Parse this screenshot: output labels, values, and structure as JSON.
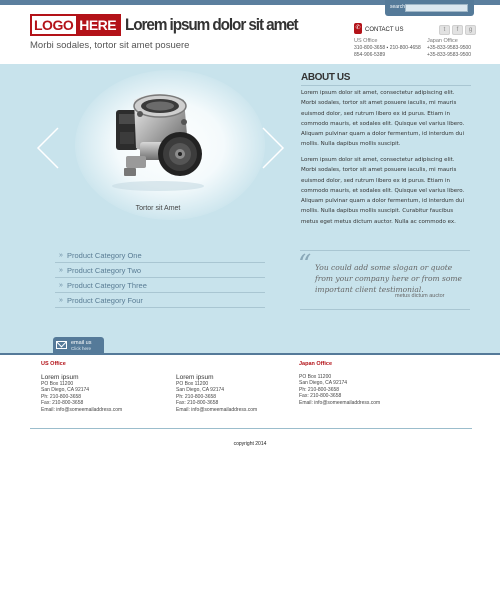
{
  "header": {
    "logo_part1": "LOGO",
    "logo_part2": "HERE",
    "site_title": "Lorem ipsum dolor sit amet",
    "tagline": "Morbi sodales, tortor sit amet posuere",
    "search": {
      "label": "search",
      "value": ""
    },
    "social": [
      {
        "icon": "twitter-icon",
        "glyph": "t"
      },
      {
        "icon": "facebook-icon",
        "glyph": "f"
      },
      {
        "icon": "googleplus-icon",
        "glyph": "g"
      }
    ],
    "contact": {
      "title": "CONTACT US",
      "us_office": {
        "name": "US Office",
        "line1": "310-800-3658 ▪ 210-800-4658",
        "line2": "854-906-5389"
      },
      "japan_office": {
        "name": "Japan Office",
        "line1": "+35-833-9583-9500",
        "line2": "+35-833-9583-9500"
      }
    }
  },
  "slider": {
    "caption": "Tortor sit Amet",
    "image": "throttle-body-product-photo"
  },
  "about": {
    "title": "ABOUT US",
    "para1": "Lorem ipsum dolor sit amet, consectetur adipiscing elit. Morbi sodales, tortor sit amet posuere iaculis, mi mauris euismod dolor, sed rutrum libero ex id purus. Etiam in commodo mauris, et sodales elit. Quisque vel varius libero. Aliquam pulvinar quam a dolor fermentum, id interdum dui mollis. Nulla dapibus mollis suscipit.",
    "para2": "Lorem ipsum dolor sit amet, consectetur adipiscing elit. Morbi sodales, tortor sit amet posuere iaculis, mi mauris euismod dolor, sed rutrum libero ex id purus. Etiam in commodo mauris, et sodales elit. Quisque vel varius libero. Aliquam pulvinar quam a dolor fermentum, id interdum dui mollis. Nulla dapibus mollis suscipit. Curabitur faucibus metus eget metus dictum auctor. Nulla ac commodo ex."
  },
  "categories": [
    "Product Category One",
    "Product Category Two",
    "Product Category Three",
    "Product Category Four"
  ],
  "quote": {
    "text": "You could add some slogan or quote from your company here or from some important client testimonial.",
    "author": "metus dictum auctor"
  },
  "email_tab": {
    "line1": "email us",
    "line2": "Click here"
  },
  "footer": {
    "col1": {
      "heading": "US Office",
      "name": "Lorem ipsum",
      "line1": "PO Box 11200",
      "line2": "San Diego, CA 92174",
      "line3": "Ph: 210-800-3658",
      "line4": "Fax: 210-800-3658",
      "line5": "Email: info@someemailaddress.com"
    },
    "col2": {
      "heading": "",
      "name": "Lorem ipsum",
      "line1": "PO Box 11200",
      "line2": "San Diego, CA 92174",
      "line3": "Ph: 210-800-3658",
      "line4": "Fax: 210-800-3658",
      "line5": "Email: info@someemailaddress.com"
    },
    "col3": {
      "heading": "Japan Office",
      "line1": "PO Box 11200",
      "line2": "San Diego, CA 92174",
      "line3": "Ph: 210-800-3658",
      "line4": "Fax: 210-800-3658",
      "line5": "Email: info@someemailaddress.com"
    },
    "copyright": "copyright 2014"
  },
  "colors": {
    "brand_red": "#b31218",
    "accent_blue": "#557a99",
    "band": "#c8e3ec"
  }
}
